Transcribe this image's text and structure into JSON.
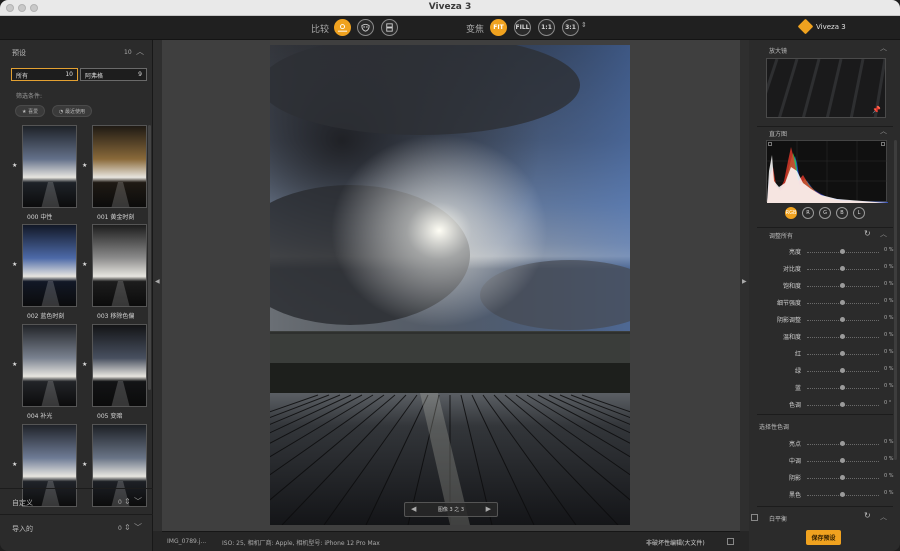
{
  "window": {
    "title": "Viveza 3"
  },
  "toolbar": {
    "compare_label": "比较",
    "zoom_label": "变焦",
    "zoom_fit": "FIT",
    "zoom_fill": "FILL",
    "zoom_1_1": "1:1",
    "zoom_3_1": "3:1",
    "brand": "Viveza 3"
  },
  "left_panel": {
    "presets": {
      "title": "预设",
      "count": "10"
    },
    "tabs": [
      {
        "label": "所有",
        "count": "10"
      },
      {
        "label": "阿弗格",
        "count": "9"
      }
    ],
    "filter_label": "筛选条件:",
    "filter_pills": [
      "★ 喜爱",
      "◔ 最近使用"
    ],
    "items": [
      {
        "label": "000 中性"
      },
      {
        "label": "001 黄金时刻"
      },
      {
        "label": "002 蓝色时刻"
      },
      {
        "label": "003 移除色偏"
      },
      {
        "label": "004 补光"
      },
      {
        "label": "005 变暗"
      },
      {
        "label": ""
      },
      {
        "label": ""
      }
    ],
    "custom": {
      "label": "自定义",
      "count": "0"
    },
    "imported": {
      "label": "导入的",
      "count": "0"
    }
  },
  "viewer": {
    "nav_text": "图像 3 之 3"
  },
  "status": {
    "filename": "IMG_0789.j...",
    "meta": "ISO: 25, 相机厂商: Apple, 相机型号: iPhone 12 Pro Max",
    "nondestructive": "非破坏性编辑(大文件)"
  },
  "right_panel": {
    "loupe_title": "放大镜",
    "histogram_title": "直方图",
    "channels": [
      "RGB",
      "R",
      "G",
      "B",
      "L"
    ],
    "adjust_title": "调整所有",
    "adjust": [
      {
        "label": "亮度",
        "value": "0 %"
      },
      {
        "label": "对比度",
        "value": "0 %"
      },
      {
        "label": "饱和度",
        "value": "0 %"
      },
      {
        "label": "细节强度",
        "value": "0 %"
      },
      {
        "label": "阴影调整",
        "value": "0 %"
      },
      {
        "label": "温和度",
        "value": "0 %"
      },
      {
        "label": "红",
        "value": "0 %"
      },
      {
        "label": "绿",
        "value": "0 %"
      },
      {
        "label": "蓝",
        "value": "0 %"
      },
      {
        "label": "色调",
        "value": "0 °"
      }
    ],
    "selective_title": "选择性色调",
    "selective": [
      {
        "label": "亮点",
        "value": "0 %"
      },
      {
        "label": "中调",
        "value": "0 %"
      },
      {
        "label": "阴影",
        "value": "0 %"
      },
      {
        "label": "黑色",
        "value": "0 %"
      }
    ],
    "balance_label": "白平衡",
    "save_label": "保存预设"
  }
}
